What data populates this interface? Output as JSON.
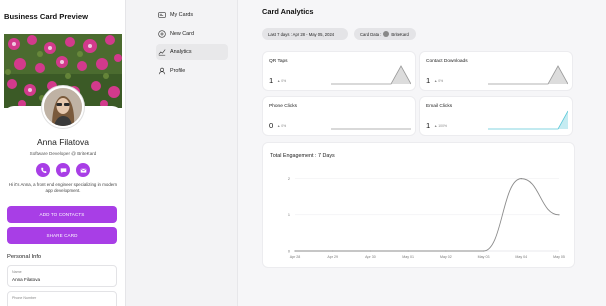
{
  "preview": {
    "title": "Business Card Preview",
    "name": "Anna Filatova",
    "role": "Software Developer @ BriteKard",
    "bio": "Hi it's Anna, a front end engineer specializing in modern app development.",
    "add_contacts_label": "ADD TO CONTACTS",
    "share_card_label": "SHARE CARD",
    "personal_info_title": "Personal Info",
    "fields": [
      {
        "label": "Name",
        "value": "Anna Filatova"
      },
      {
        "label": "Phone Number",
        "value": ""
      }
    ],
    "accent_color": "#a83ee6"
  },
  "nav": {
    "items": [
      {
        "label": "My Cards",
        "icon": "card-icon"
      },
      {
        "label": "New Card",
        "icon": "plus-circle-icon"
      },
      {
        "label": "Analytics",
        "icon": "chart-icon"
      },
      {
        "label": "Profile",
        "icon": "user-icon"
      }
    ],
    "active_index": 2
  },
  "analytics": {
    "title": "Card Analytics",
    "date_range": "Last 7 days : Apr 28 - May 05, 2024",
    "card_filter": "Card Data :",
    "card_name": "BriteKard",
    "stats": [
      {
        "title": "QR Taps",
        "value": "1",
        "change": "▲ 0%",
        "sparkline": [
          0,
          0,
          0,
          0,
          0,
          0,
          0,
          1,
          0
        ],
        "color": "#9a9a9a"
      },
      {
        "title": "Contact Downloads",
        "value": "1",
        "change": "▲ 0%",
        "sparkline": [
          0,
          0,
          0,
          0,
          0,
          0,
          0,
          1,
          0
        ],
        "color": "#9a9a9a"
      },
      {
        "title": "Phone Clicks",
        "value": "0",
        "change": "▲ 0%",
        "sparkline": [
          0,
          0,
          0,
          0,
          0,
          0,
          0,
          0,
          0
        ],
        "color": "#9a9a9a"
      },
      {
        "title": "Email Clicks",
        "value": "1",
        "change": "▲ 100%",
        "sparkline": [
          0,
          0,
          0,
          0,
          0,
          0,
          0,
          0,
          1
        ],
        "color": "#5cc9d9"
      }
    ],
    "engagement_title": "Total Engagement : 7 Days"
  },
  "chart_data": {
    "type": "line",
    "title": "Total Engagement : 7 Days",
    "categories": [
      "Apr 28",
      "Apr 29",
      "Apr 30",
      "May 01",
      "May 02",
      "May 03",
      "May 04",
      "May 05"
    ],
    "series": [
      {
        "values": [
          0,
          0,
          0,
          0,
          0,
          0,
          2,
          1
        ]
      }
    ],
    "yticks": [
      0,
      1,
      2
    ],
    "ylim": [
      0,
      2.1
    ],
    "color": "#8c8c8c"
  }
}
